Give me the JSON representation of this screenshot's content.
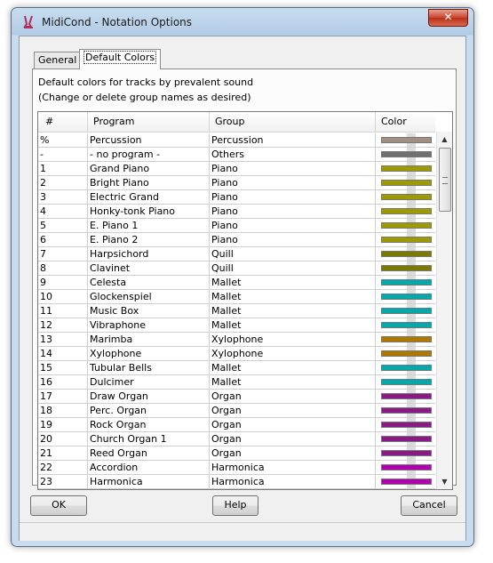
{
  "window": {
    "title": "MidiCond - Notation Options",
    "close_glyph": "✕"
  },
  "tabs": [
    {
      "label": "General",
      "active": false
    },
    {
      "label": "Default Colors",
      "active": true
    }
  ],
  "panel": {
    "desc1": "Default colors for tracks by prevalent sound",
    "desc2": "(Change or delete group names as desired)"
  },
  "table": {
    "headers": {
      "num": "#",
      "program": "Program",
      "group": "Group",
      "color": "Color"
    },
    "rows": [
      {
        "num": "%",
        "program": "Percussion",
        "group": "Percussion",
        "color": "#a28f83"
      },
      {
        "num": "-",
        "program": "- no program -",
        "group": "Others",
        "color": "#707070"
      },
      {
        "num": "1",
        "program": "Grand Piano",
        "group": "Piano",
        "color": "#9c9c00"
      },
      {
        "num": "2",
        "program": "Bright Piano",
        "group": "Piano",
        "color": "#9c9c00"
      },
      {
        "num": "3",
        "program": "Electric Grand",
        "group": "Piano",
        "color": "#9c9c00"
      },
      {
        "num": "4",
        "program": "Honky-tonk Piano",
        "group": "Piano",
        "color": "#9c9c00"
      },
      {
        "num": "5",
        "program": "E. Piano 1",
        "group": "Piano",
        "color": "#9c9c00"
      },
      {
        "num": "6",
        "program": "E. Piano 2",
        "group": "Piano",
        "color": "#9c9c00"
      },
      {
        "num": "7",
        "program": "Harpsichord",
        "group": "Quill",
        "color": "#7a7a00"
      },
      {
        "num": "8",
        "program": "Clavinet",
        "group": "Quill",
        "color": "#7a7a00"
      },
      {
        "num": "9",
        "program": "Celesta",
        "group": "Mallet",
        "color": "#00aaaa"
      },
      {
        "num": "10",
        "program": "Glockenspiel",
        "group": "Mallet",
        "color": "#00aaaa"
      },
      {
        "num": "11",
        "program": "Music Box",
        "group": "Mallet",
        "color": "#00aaaa"
      },
      {
        "num": "12",
        "program": "Vibraphone",
        "group": "Mallet",
        "color": "#00aaaa"
      },
      {
        "num": "13",
        "program": "Marimba",
        "group": "Xylophone",
        "color": "#b07800"
      },
      {
        "num": "14",
        "program": "Xylophone",
        "group": "Xylophone",
        "color": "#b07800"
      },
      {
        "num": "15",
        "program": "Tubular Bells",
        "group": "Mallet",
        "color": "#00aaaa"
      },
      {
        "num": "16",
        "program": "Dulcimer",
        "group": "Mallet",
        "color": "#00aaaa"
      },
      {
        "num": "17",
        "program": "Draw Organ",
        "group": "Organ",
        "color": "#8a1a8a"
      },
      {
        "num": "18",
        "program": "Perc. Organ",
        "group": "Organ",
        "color": "#8a1a8a"
      },
      {
        "num": "19",
        "program": "Rock Organ",
        "group": "Organ",
        "color": "#8a1a8a"
      },
      {
        "num": "20",
        "program": "Church Organ 1",
        "group": "Organ",
        "color": "#8a1a8a"
      },
      {
        "num": "21",
        "program": "Reed Organ",
        "group": "Organ",
        "color": "#8a1a8a"
      },
      {
        "num": "22",
        "program": "Accordion",
        "group": "Harmonica",
        "color": "#b000b0"
      },
      {
        "num": "23",
        "program": "Harmonica",
        "group": "Harmonica",
        "color": "#b000b0"
      }
    ]
  },
  "buttons": {
    "ok": "OK",
    "help": "Help",
    "cancel": "Cancel"
  },
  "scrollbar": {
    "up": "▲",
    "down": "▼"
  }
}
